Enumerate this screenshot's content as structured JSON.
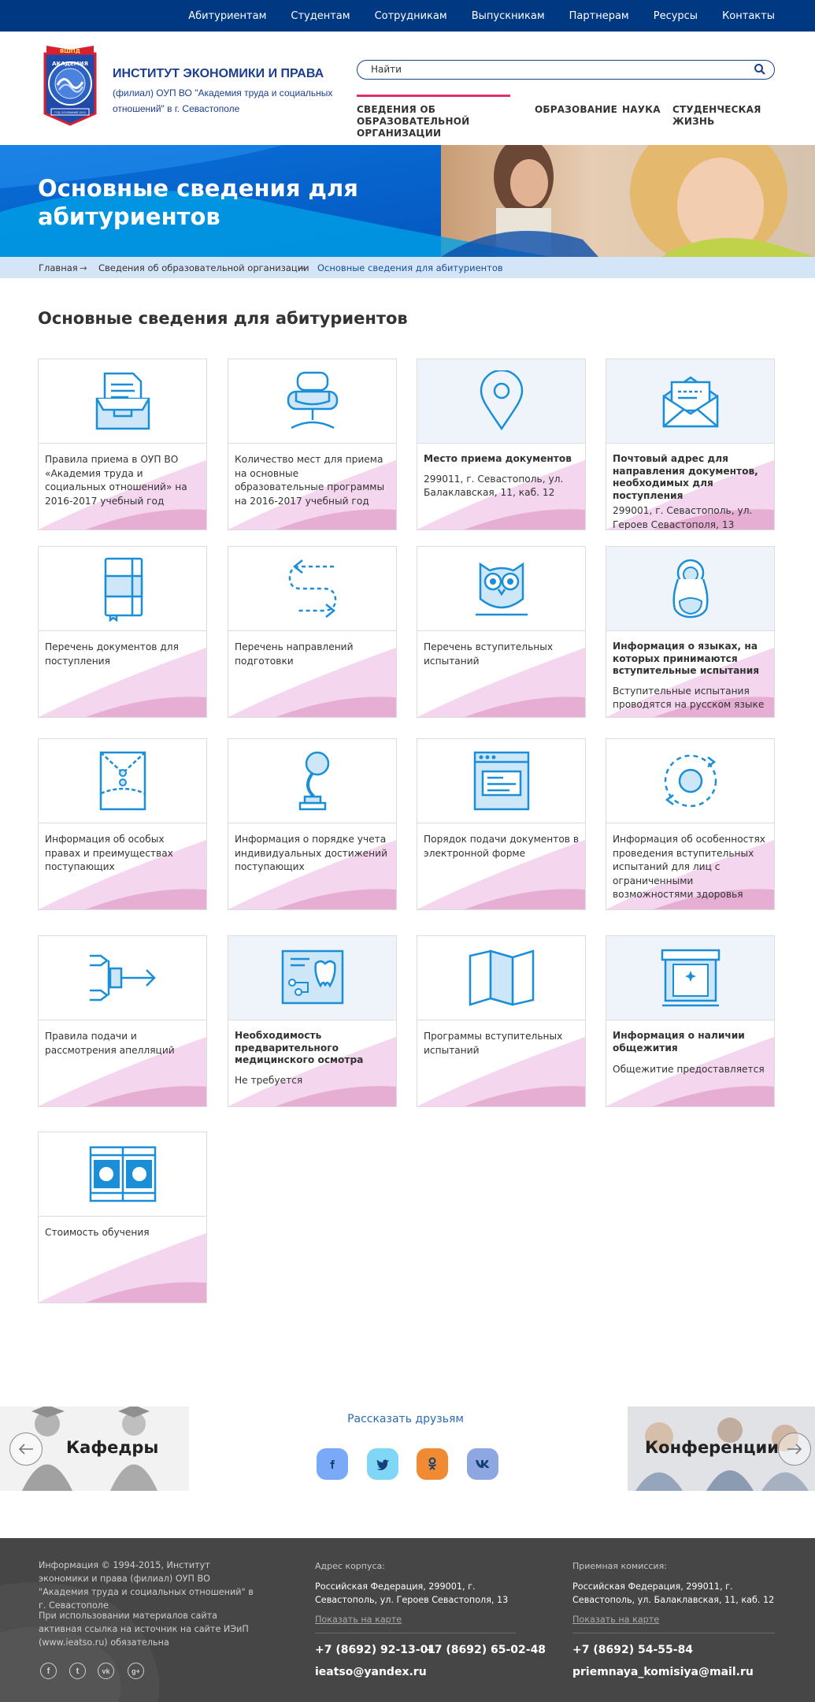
{
  "top_nav": [
    "Абитуриентам",
    "Студентам",
    "Сотрудникам",
    "Выпускникам",
    "Партнерам",
    "Ресурсы",
    "Контакты"
  ],
  "institute": {
    "title": "ИНСТИТУТ ЭКОНОМИКИ И ПРАВА",
    "subtitle": "(филиал) ОУП ВО \"Академия труда и социальных отношений\" в г. Севастополе",
    "logo_text": [
      "ВШПД",
      "АКАДЕМИЯ",
      "ГОД ОСНОВАНИЯ 1919"
    ]
  },
  "search": {
    "placeholder": "Найти"
  },
  "main_nav": [
    {
      "label": "СВЕДЕНИЯ ОБ ОБРАЗОВАТЕЛЬНОЙ ОРГАНИЗАЦИИ"
    },
    {
      "label": "ОБРАЗОВАНИЕ"
    },
    {
      "label": "НАУКА"
    },
    {
      "label": "СТУДЕНЧЕСКАЯ ЖИЗНЬ"
    }
  ],
  "hero": {
    "title": "Основные сведения для абитуриентов"
  },
  "breadcrumb": [
    "Главная",
    "Сведения об образовательной организации",
    "Основные сведения для абитуриентов"
  ],
  "page_title": "Основные сведения для абитуриентов",
  "cards": [
    {
      "icon": "archive-box-icon",
      "text": "Правила приема в ОУП ВО «Академия труда и социальных отношений» на 2016-2017 учебный год"
    },
    {
      "icon": "armchair-icon",
      "text": "Количество мест для приема на основные образовательные программы на 2016-2017 учебный год"
    },
    {
      "icon": "location-pin-icon",
      "title": "Место приема документов",
      "sub": "299011, г. Севастополь, ул. Балаклавская, 11, каб. 12"
    },
    {
      "icon": "envelope-icon",
      "title": "Почтовый адрес для направления документов, необходимых для поступления",
      "sub": "299001, г. Севастополь, ул. Героев Севастополя, 13"
    },
    {
      "icon": "notebook-icon",
      "text": "Перечень документов для поступления"
    },
    {
      "icon": "route-arrows-icon",
      "text": "Перечень направлений подготовки"
    },
    {
      "icon": "owl-icon",
      "text": "Перечень вступительных испытаний"
    },
    {
      "icon": "matryoshka-icon",
      "title": "Информация о языках, на которых принимаются вступительные испытания",
      "sub": "Вступительные испытания проводятся на русском языке"
    },
    {
      "icon": "sealed-envelope-icon",
      "text": "Информация об особых правах и преимуществах поступающих"
    },
    {
      "icon": "trophy-icon",
      "text": "Информация о порядке учета индивидуальных достижений поступающих"
    },
    {
      "icon": "browser-window-icon",
      "text": "Порядок подачи документов в электронной форме"
    },
    {
      "icon": "cycle-arrows-icon",
      "text": "Информация об особенностях проведения вступительных испытаний для лиц с ограниченными возможностями здоровья"
    },
    {
      "icon": "appeal-arrows-icon",
      "text": "Правила подачи и рассмотрения апелляций"
    },
    {
      "icon": "xray-tooth-icon",
      "title": "Необходимость предварительного медицинского осмотра",
      "sub": "Не требуется"
    },
    {
      "icon": "folded-map-icon",
      "text": "Программы вступительных испытаний"
    },
    {
      "icon": "window-icon",
      "title": "Информация о наличии общежития",
      "sub": "Общежитие предоставляется"
    },
    {
      "icon": "banknotes-icon",
      "text": "Стоимость обучения"
    }
  ],
  "share": {
    "label": "Рассказать друзьям"
  },
  "social": [
    {
      "icon": "facebook-icon",
      "glyph": "f",
      "color": "#7aaaf7"
    },
    {
      "icon": "twitter-icon",
      "glyph": "t",
      "color": "#7fd6f5"
    },
    {
      "icon": "odnoklassniki-icon",
      "glyph": "ok",
      "color": "#f08a33"
    },
    {
      "icon": "vk-icon",
      "glyph": "vk",
      "color": "#8ea6e2"
    }
  ],
  "promos": {
    "left": "Кафедры",
    "right": "Конференции"
  },
  "footer": {
    "copyright": "Информация © 1994-2015, Институт экономики и права (филиал) ОУП ВО \"Академия труда и социальных отношений\" в г. Севастополе",
    "notice": "При использовании материалов сайта активная ссылка на источник на сайте ИЭиП (www.ieatso.ru) обязательна",
    "col2": {
      "head": "Адрес корпуса:",
      "address": "Российская Федерация, 299001, г. Севастополь, ул. Героев Севастополя, 13",
      "map": "Показать на карте",
      "phone1": "+7 (8692) 92-13-01",
      "phone2": "+7 (8692) 65-02-48",
      "email": "ieatso@yandex.ru"
    },
    "col3": {
      "head": "Приемная комиссия:",
      "address": "Российская Федерация, 299011, г. Севастополь, ул. Балаклавская, 11, каб. 12",
      "map": "Показать на карте",
      "phone": "+7 (8692) 54-55-84",
      "email": "priemnaya_komisiya@mail.ru"
    },
    "icons": [
      {
        "icon": "facebook-icon",
        "glyph": "f"
      },
      {
        "icon": "twitter-icon",
        "glyph": "t"
      },
      {
        "icon": "vk-icon",
        "glyph": "vk"
      },
      {
        "icon": "google-plus-icon",
        "glyph": "g+"
      }
    ]
  },
  "colors": {
    "top_bar": "#003882",
    "brand_text": "#1c3e8e",
    "accent_pink": "#e0306b",
    "icon_blue": "#1a8fd8",
    "breadcrumb_bg": "#d4e5f8",
    "footer_bg": "#464646"
  }
}
